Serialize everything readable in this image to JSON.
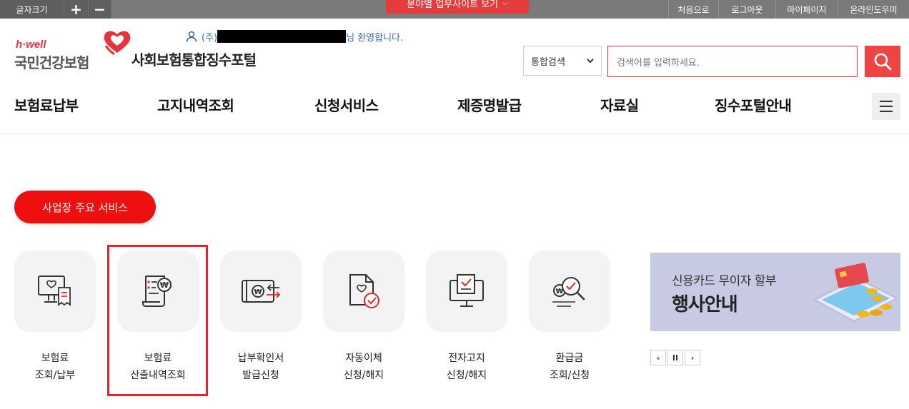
{
  "topbar": {
    "font_size_label": "글자크기",
    "font_plus": "+",
    "font_minus": "−",
    "site_menu_label": "분야별 업무사이트 보기",
    "utility": [
      "처음으로",
      "로그아웃",
      "마이페이지",
      "온라인도우미"
    ]
  },
  "header": {
    "logo_tagline": "h·well",
    "logo_name": "국민건강보험",
    "portal_title": "사회보험통합징수포털",
    "welcome_prefix": "(주)",
    "welcome_suffix": "님 환영합니다."
  },
  "search": {
    "scope": "통합검색",
    "placeholder": "검색어를 입력하세요."
  },
  "gnb": [
    "보험료납부",
    "고지내역조회",
    "신청서비스",
    "제증명발급",
    "자료실",
    "징수포털안내"
  ],
  "main": {
    "section_button": "사업장 주요 서비스",
    "services": [
      {
        "line1": "보험료",
        "line2": "조회/납부",
        "icon": "monitor-receipt-icon"
      },
      {
        "line1": "보험료",
        "line2": "산출내역조회",
        "icon": "won-document-icon"
      },
      {
        "line1": "납부확인서",
        "line2": "발급신청",
        "icon": "won-card-arrows-icon"
      },
      {
        "line1": "자동이체",
        "line2": "신청/해지",
        "icon": "document-check-icon"
      },
      {
        "line1": "전자고지",
        "line2": "신청/해지",
        "icon": "computer-check-icon"
      },
      {
        "line1": "환급금",
        "line2": "조회/신청",
        "icon": "won-magnifier-check-icon"
      }
    ]
  },
  "banner": {
    "line1": "신용카드 무이자 할부",
    "line2": "행사안내",
    "prev": "‹",
    "pause": "II",
    "next": "›"
  },
  "colors": {
    "brand_red": "#e8333b",
    "pill_red": "#ee0f0f",
    "search_btn": "#ee4444",
    "topbar_gray": "#7a7a7a",
    "highlight": "#e52629"
  }
}
